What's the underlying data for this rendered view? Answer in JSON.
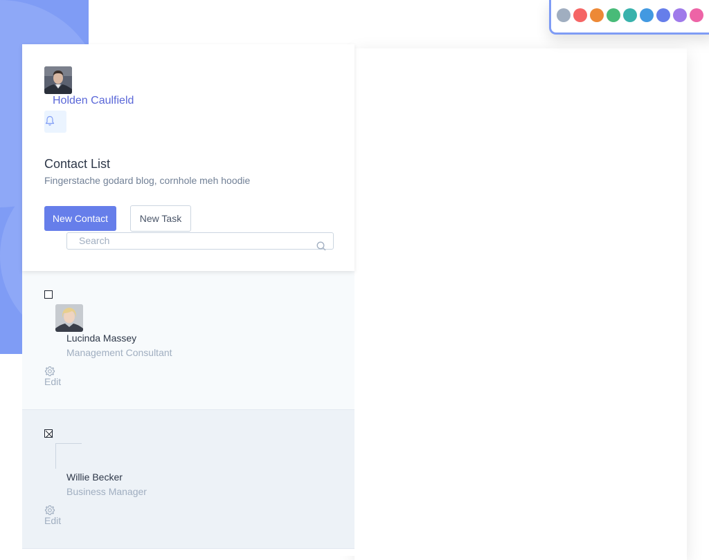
{
  "user": {
    "name": "Holden Caulfield"
  },
  "header": {
    "title": "Contact List",
    "subtitle": "Fingerstache godard blog, cornhole meh hoodie",
    "new_contact_label": "New Contact",
    "new_task_label": "New Task"
  },
  "search": {
    "placeholder": "Search"
  },
  "contacts": [
    {
      "name": "Lucinda Massey",
      "role": "Management Consultant",
      "edit_label": "Edit",
      "checked": false
    },
    {
      "name": "Willie Becker",
      "role": "Business Manager",
      "edit_label": "Edit",
      "checked": true
    }
  ],
  "swatches": [
    "#a0aec0",
    "#f56565",
    "#ed8936",
    "#48bb78",
    "#38b2ac",
    "#4299e1",
    "#667eea",
    "#9f7aea",
    "#ed64a6"
  ],
  "colors": {
    "accent": "#667eea",
    "brand_light": "#7f9cf5",
    "name_link": "#5a67d8"
  },
  "icons": {
    "notifications": "bell-icon",
    "search": "search-icon",
    "edit": "gear-icon"
  }
}
